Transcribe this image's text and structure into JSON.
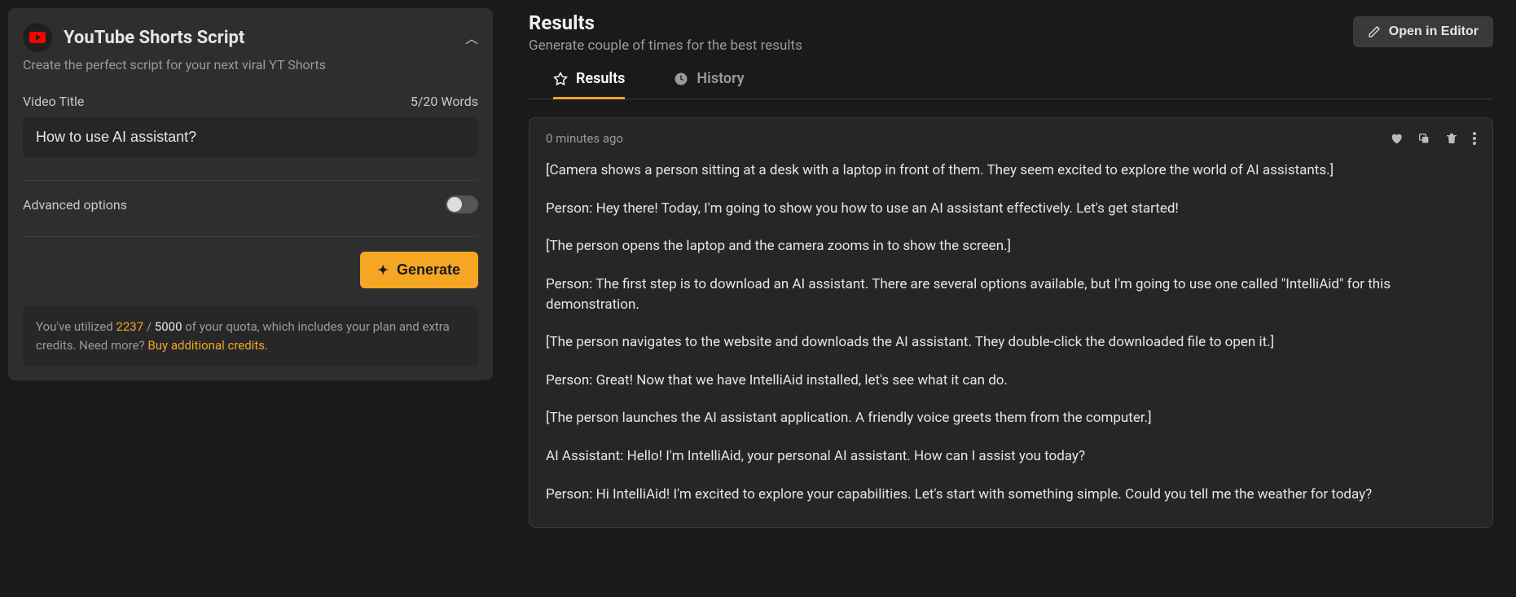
{
  "leftPanel": {
    "title": "YouTube Shorts Script",
    "subtitle": "Create the perfect script for your next viral YT Shorts",
    "videoTitleLabel": "Video Title",
    "wordCount": "5/20 Words",
    "videoTitleValue": "How to use AI assistant?",
    "advancedLabel": "Advanced options",
    "generateLabel": "Generate",
    "quota": {
      "prefix": "You've utilized ",
      "used": "2237",
      "sep": " / ",
      "total": "5000",
      "suffix": " of your quota, which includes your plan and extra credits. Need more? ",
      "link": "Buy additional credits."
    }
  },
  "rightPanel": {
    "title": "Results",
    "subtitle": "Generate couple of times for the best results",
    "openEditor": "Open in Editor",
    "tabs": {
      "results": "Results",
      "history": "History"
    },
    "result": {
      "timestamp": "0 minutes ago",
      "paragraphs": [
        "[Camera shows a person sitting at a desk with a laptop in front of them. They seem excited to explore the world of AI assistants.]",
        "Person: Hey there! Today, I'm going to show you how to use an AI assistant effectively. Let's get started!",
        "[The person opens the laptop and the camera zooms in to show the screen.]",
        "Person: The first step is to download an AI assistant. There are several options available, but I'm going to use one called \"IntelliAid\" for this demonstration.",
        "[The person navigates to the website and downloads the AI assistant. They double-click the downloaded file to open it.]",
        "Person: Great! Now that we have IntelliAid installed, let's see what it can do.",
        "[The person launches the AI assistant application. A friendly voice greets them from the computer.]",
        "AI Assistant: Hello! I'm IntelliAid, your personal AI assistant. How can I assist you today?",
        "Person: Hi IntelliAid! I'm excited to explore your capabilities. Let's start with something simple. Could you tell me the weather for today?"
      ]
    }
  }
}
